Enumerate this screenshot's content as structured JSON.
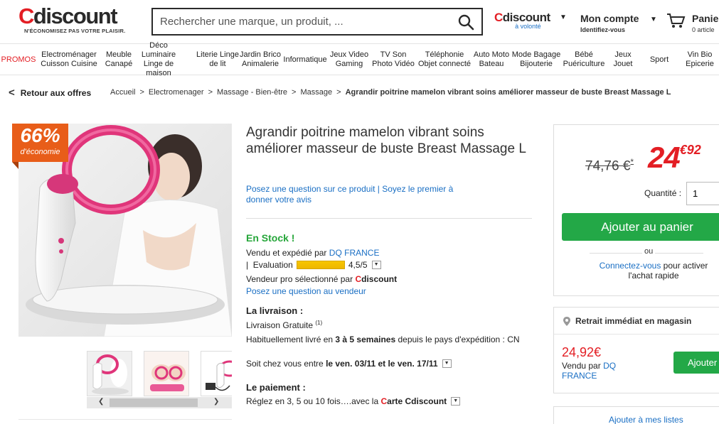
{
  "header": {
    "logo_word_c": "C",
    "logo_word_rest": "discount",
    "logo_tagline": "N'ÉCONOMISEZ PAS VOTRE PLAISIR.",
    "search_placeholder": "Rechercher une marque, un produit, ...",
    "search_icon": "magnifier-icon",
    "volonte_c": "C",
    "volonte_rest": "discount",
    "volonte_sub": "à volonté",
    "account_title": "Mon compte",
    "account_sub": "Identifiez-vous",
    "cart_title": "Panier",
    "cart_sub": "0 article"
  },
  "nav": [
    {
      "label": "PROMOS"
    },
    {
      "label": "Electroménager Cuisson Cuisine"
    },
    {
      "label": "Meuble Canapé"
    },
    {
      "label": "Déco Luminaire Linge de maison"
    },
    {
      "label": "Literie Linge de lit"
    },
    {
      "label": "Jardin Brico Animalerie"
    },
    {
      "label": "Informatique"
    },
    {
      "label": "Jeux Video Gaming"
    },
    {
      "label": "TV Son Photo Vidéo"
    },
    {
      "label": "Téléphonie Objet connecté"
    },
    {
      "label": "Auto Moto Bateau"
    },
    {
      "label": "Mode Bagage Bijouterie"
    },
    {
      "label": "Bébé Puériculture"
    },
    {
      "label": "Jeux Jouet"
    },
    {
      "label": "Sport"
    },
    {
      "label": "Vin Bio Epicerie"
    }
  ],
  "breadcrumb": {
    "back": "Retour aux offres",
    "items": [
      "Accueil",
      "Electromenager",
      "Massage - Bien-être",
      "Massage"
    ],
    "current": "Agrandir poitrine mamelon vibrant soins améliorer masseur de buste Breast Massage L"
  },
  "badge": {
    "percent": "66%",
    "label": "d'économie",
    "color": "#e85d19"
  },
  "product": {
    "title": "Agrandir poitrine mamelon vibrant soins améliorer masseur de buste Breast Massage L",
    "ask_question": "Posez une question sur ce produit",
    "review_first": "Soyez le premier à donner votre avis",
    "stock": "En Stock !",
    "sold_by_prefix": "Vendu et expédié par",
    "seller": "DQ FRANCE",
    "evaluation_label": "Evaluation",
    "evaluation_score": "4,5/5",
    "seller_pro_prefix": "Vendeur pro sélectionné par",
    "seller_pro_c": "C",
    "seller_pro_rest": "discount",
    "ask_seller": "Posez une question au vendeur",
    "delivery_title": "La livraison :",
    "delivery_free": "Livraison Gratuite",
    "delivery_note": "(1)",
    "delivery_time_prefix": "Habituellement livré en",
    "delivery_time_bold": "3 à 5 semaines",
    "delivery_time_suffix": "depuis le pays d'expédition : CN",
    "delivery_date_prefix": "Soit chez vous entre",
    "delivery_date_bold": "le ven. 03/11 et le ven. 17/11",
    "payment_title": "Le paiement :",
    "payment_prefix": "Réglez en 3, 5 ou 10 fois….avec la",
    "payment_card_c": "C",
    "payment_card_rest": "arte Cdiscount"
  },
  "price_box": {
    "old_price": "74,76 €",
    "old_price_mark": "*",
    "price_int": "24",
    "price_dec": "€92",
    "quantity_label": "Quantité :",
    "quantity_value": "1",
    "add_to_cart": "Ajouter au panier",
    "or": "ou",
    "connect_link": "Connectez-vous",
    "connect_suffix": "pour activer l'achat rapide",
    "accent": "#23a847",
    "price_color": "#e31e24"
  },
  "store_box": {
    "title": "Retrait immédiat en magasin",
    "price": "24,92€",
    "seller_prefix": "Vendu par",
    "seller": "DQ FRANCE",
    "add": "Ajouter"
  },
  "lists_box": {
    "link": "Ajouter à mes listes"
  }
}
